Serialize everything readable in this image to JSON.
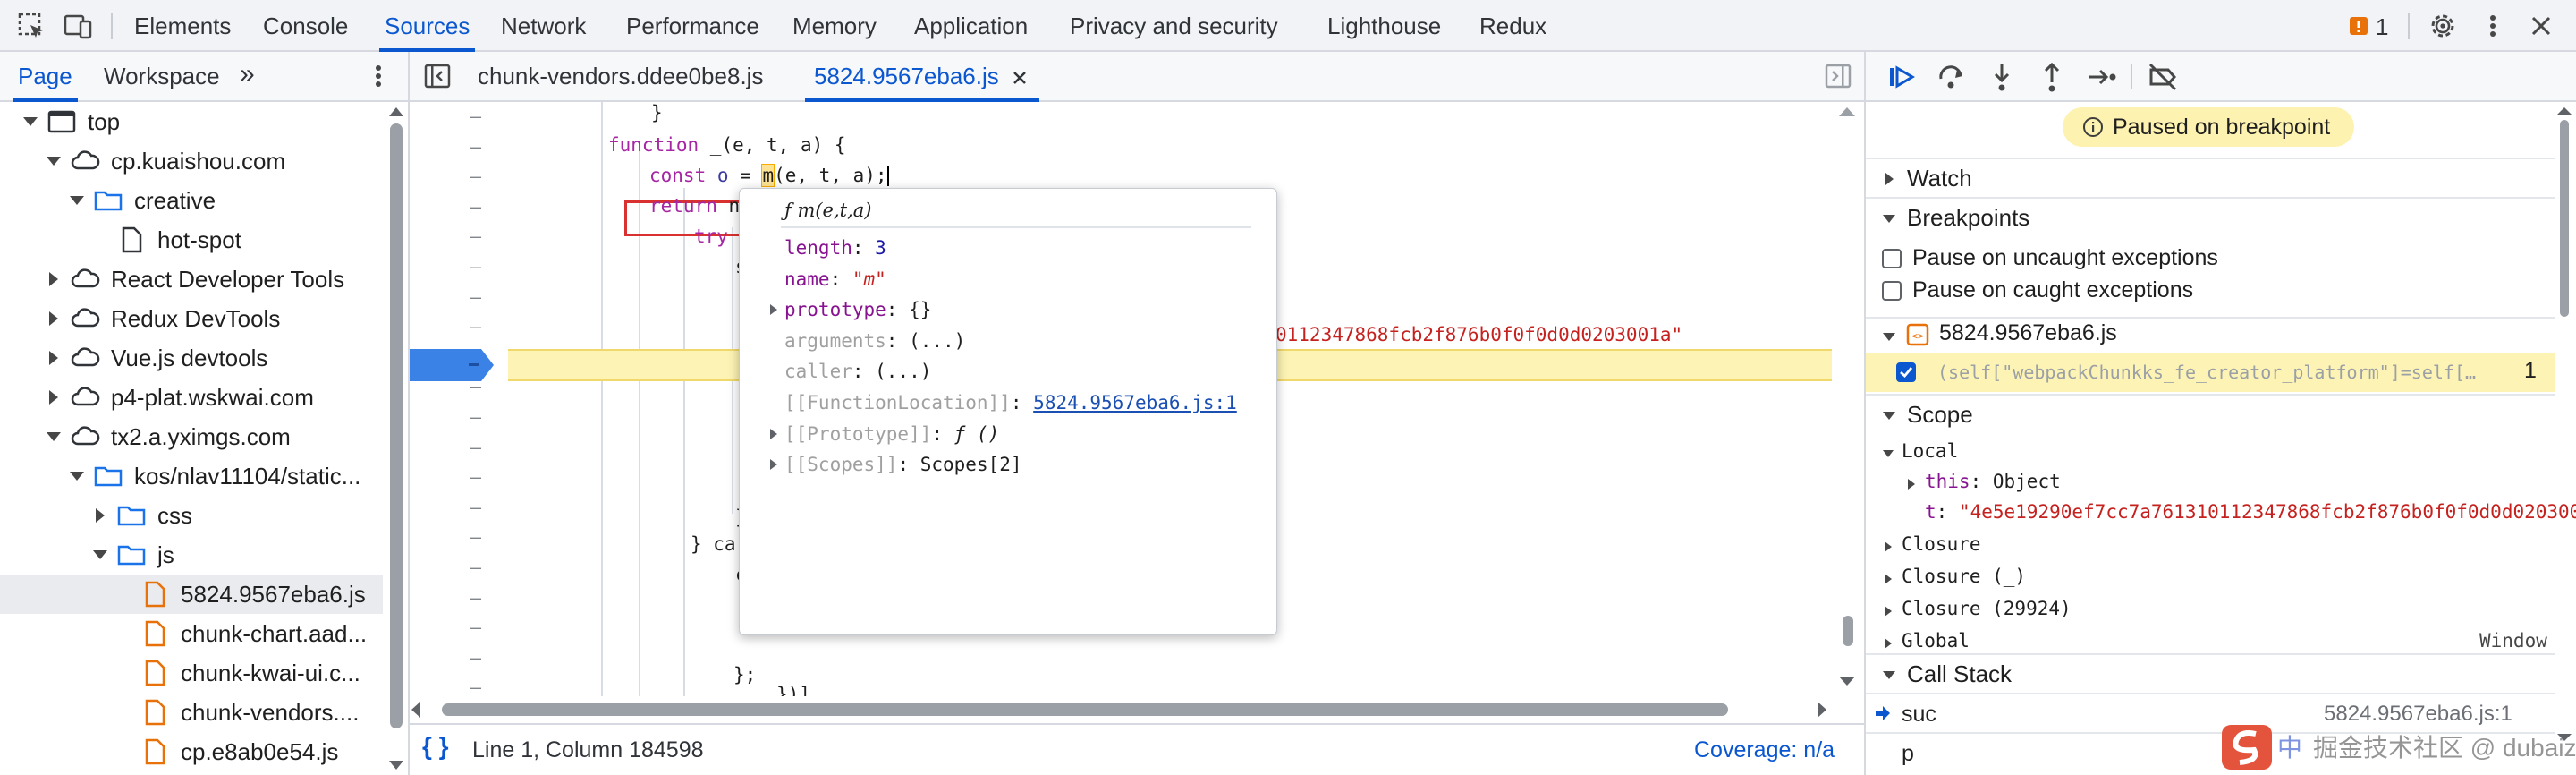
{
  "toolbar": {
    "tabs": [
      "Elements",
      "Console",
      "Sources",
      "Network",
      "Performance",
      "Memory",
      "Application",
      "Privacy and security",
      "Lighthouse",
      "Redux"
    ],
    "active_tab": "Sources",
    "issues_count": "1"
  },
  "navigator": {
    "tabs": [
      "Page",
      "Workspace"
    ],
    "more": "»",
    "tree": [
      {
        "label": "top",
        "depth": 0,
        "arrow": "open",
        "icon": "frame"
      },
      {
        "label": "cp.kuaishou.com",
        "depth": 1,
        "arrow": "open",
        "icon": "cloud"
      },
      {
        "label": "creative",
        "depth": 2,
        "arrow": "open",
        "icon": "folder"
      },
      {
        "label": "hot-spot",
        "depth": 3,
        "arrow": "none",
        "icon": "file"
      },
      {
        "label": "React Developer Tools",
        "depth": 1,
        "arrow": "closed",
        "icon": "cloud"
      },
      {
        "label": "Redux DevTools",
        "depth": 1,
        "arrow": "closed",
        "icon": "cloud"
      },
      {
        "label": "Vue.js devtools",
        "depth": 1,
        "arrow": "closed",
        "icon": "cloud"
      },
      {
        "label": "p4-plat.wskwai.com",
        "depth": 1,
        "arrow": "closed",
        "icon": "cloud"
      },
      {
        "label": "tx2.a.yximgs.com",
        "depth": 1,
        "arrow": "open",
        "icon": "cloud"
      },
      {
        "label": "kos/nlav11104/static...",
        "depth": 2,
        "arrow": "open",
        "icon": "folder"
      },
      {
        "label": "css",
        "depth": 3,
        "arrow": "closed",
        "icon": "folder"
      },
      {
        "label": "js",
        "depth": 3,
        "arrow": "open",
        "icon": "folder"
      },
      {
        "label": "5824.9567eba6.js",
        "depth": 4,
        "arrow": "none",
        "icon": "jsfile",
        "selected": true
      },
      {
        "label": "chunk-chart.aad...",
        "depth": 4,
        "arrow": "none",
        "icon": "jsfile"
      },
      {
        "label": "chunk-kwai-ui.c...",
        "depth": 4,
        "arrow": "none",
        "icon": "jsfile"
      },
      {
        "label": "chunk-vendors....",
        "depth": 4,
        "arrow": "none",
        "icon": "jsfile"
      },
      {
        "label": "cp.e8ab0e54.js",
        "depth": 4,
        "arrow": "none",
        "icon": "jsfile"
      }
    ]
  },
  "editor": {
    "tabs": [
      "chunk-vendors.ddee0be8.js",
      "5824.9567eba6.js"
    ],
    "active_tab": "5824.9567eba6.js",
    "code": {
      "l0": "}",
      "l1_kw": "function",
      "l1_rest": " _(e, t, a) {",
      "l2_kw": "const",
      "l2_var": " o",
      "l2_eq": " = ",
      "l2_fn": "m",
      "l2_rest": "(e, t, a);",
      "l3_kw": "return",
      "l3_rest": " ne",
      "l4_kw": "try",
      "l4_rest": " {",
      "l5": "s",
      "l5_str": "0112347868fcb2f876b0f0f0d0d0203001a\"",
      "l12": "}",
      "l13": "} ca",
      "l14": "c",
      "l19": "})]",
      "l20": "};"
    },
    "status": {
      "position": "Line 1, Column 184598",
      "coverage": "Coverage: n/a"
    }
  },
  "popover": {
    "title": "ƒ m(e,t,a)",
    "rows": [
      {
        "key": "length",
        "sep": ": ",
        "value": "3",
        "kind": "num"
      },
      {
        "key": "name",
        "sep": ": ",
        "value": "\"m\"",
        "kind": "str"
      },
      {
        "key": "prototype",
        "sep": ": ",
        "value": "{}",
        "kind": "plain",
        "arrow": true
      },
      {
        "key": "arguments",
        "sep": ": ",
        "value": "(...)",
        "kind": "plain",
        "dim": true
      },
      {
        "key": "caller",
        "sep": ": ",
        "value": "(...)",
        "kind": "plain",
        "dim": true
      },
      {
        "key": "[[FunctionLocation]]",
        "sep": ": ",
        "value": "5824.9567eba6.js:1",
        "kind": "link",
        "dim": true
      },
      {
        "key": "[[Prototype]]",
        "sep": ": ",
        "value": "ƒ ()",
        "kind": "fn",
        "dim": true,
        "arrow": true
      },
      {
        "key": "[[Scopes]]",
        "sep": ": ",
        "value": "Scopes[2]",
        "kind": "plain",
        "dim": true,
        "arrow": true
      }
    ]
  },
  "debugger": {
    "paused_banner": "Paused on breakpoint",
    "watch": "Watch",
    "breakpoints": "Breakpoints",
    "pause_uncaught": "Pause on uncaught exceptions",
    "pause_caught": "Pause on caught exceptions",
    "bp_file": "5824.9567eba6.js",
    "bp_code": "(self[\"webpackChunkks_fe_creator_platform\"]=self[…",
    "bp_line": "1",
    "scope": "Scope",
    "local": "Local",
    "this_key": "this",
    "this_val": "Object",
    "t_key": "t",
    "t_val": "\"4e5e19290ef7cc7a761310112347868fcb2f876b0f0f0d0d020300",
    "closure1": "Closure",
    "closure2": "Closure (_)",
    "closure3": "Closure (29924)",
    "global": "Global",
    "global_val": "Window",
    "callstack": "Call Stack",
    "frames": [
      {
        "name": "suc",
        "loc": "5824.9567eba6.js:1",
        "current": true
      },
      {
        "name": "p",
        "loc": ""
      }
    ]
  },
  "watermark": "掘金技术社区 @ dubaiz",
  "watermark_logo": "中"
}
